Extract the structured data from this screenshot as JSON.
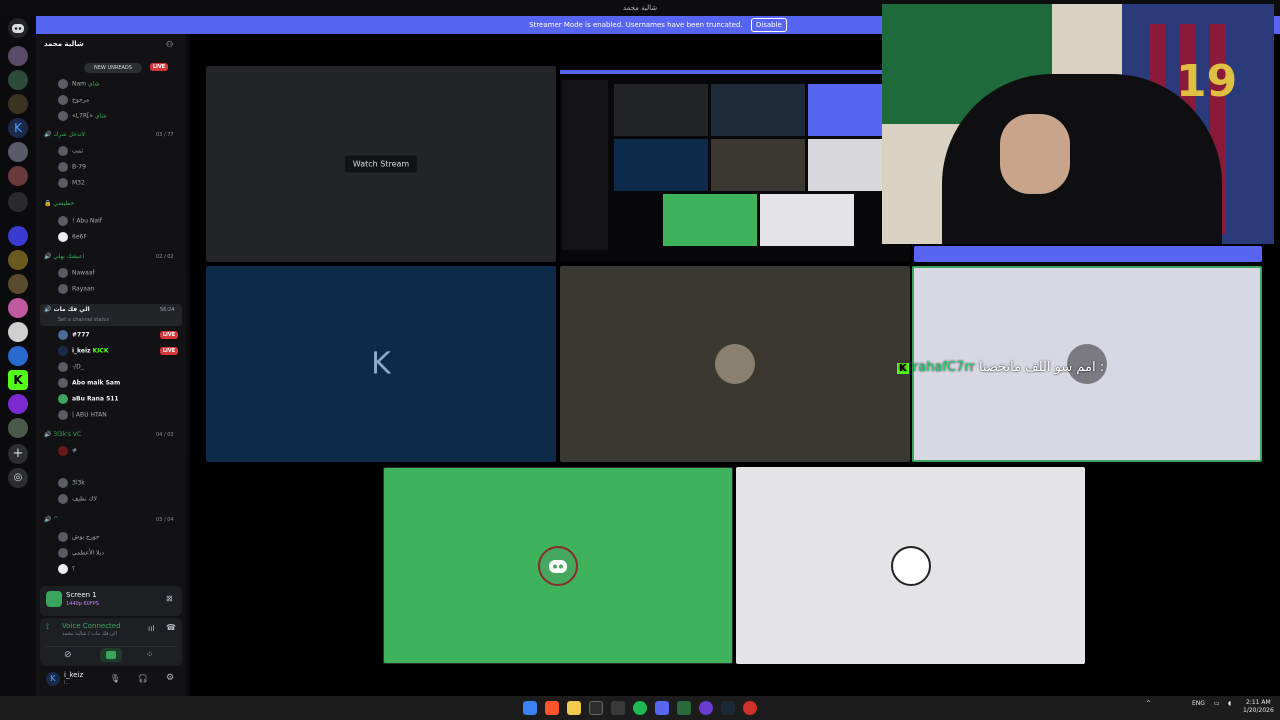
{
  "window": {
    "title": "شالية محمد"
  },
  "banner": {
    "text": "Streamer Mode is enabled. Usernames have been truncated.",
    "disable_label": "Disable"
  },
  "sidebar": {
    "guild_name": "شالية محمد",
    "new_unreads": "NEW UNREADS",
    "channels": [
      {
        "label": "Nam",
        "tag": "شاي"
      },
      {
        "label": "مرجوح"
      },
      {
        "label": "«L7R[»",
        "tag": "شاي"
      },
      {
        "label": "لاتدخل شرك",
        "kind": "category",
        "count": "03 / 77"
      },
      {
        "label": "تمب"
      },
      {
        "label": "B-79"
      },
      {
        "label": "M32"
      },
      {
        "label": "خطيشي",
        "kind": "category"
      },
      {
        "label": "! Abu Naif"
      },
      {
        "label": "6e6F"
      },
      {
        "label": "اعيشك بهلي",
        "kind": "category",
        "count": "02 / 02"
      },
      {
        "label": "Nawaaf"
      },
      {
        "label": "Rayaan"
      },
      {
        "label": "الي فك مات",
        "kind": "category-selected",
        "count": "56:24",
        "status": "Set a channel status"
      },
      {
        "label": "#777",
        "live": "LIVE"
      },
      {
        "label": "i_keiz",
        "tag": "KICK",
        "live": "LIVE"
      },
      {
        "label": "-/D_"
      },
      {
        "label": "Abo malk",
        "tag": "Sam"
      },
      {
        "label": "aBu Rana",
        "tag": "511"
      },
      {
        "label": "| ABU HTAN"
      },
      {
        "label": "3l3k's VC",
        "kind": "category",
        "count": "04 / 03"
      },
      {
        "label": "#"
      },
      {
        "label": "3l3k"
      },
      {
        "label": "لاك",
        "tag": "نظيف"
      },
      {
        "label": "^",
        "kind": "category",
        "count": "03 / 04"
      },
      {
        "label": "جورج بوش"
      },
      {
        "label": "ديلا الأعظمي"
      },
      {
        "label": "؟"
      }
    ],
    "screen_share": {
      "title": "Screen 1",
      "sub": "1440p 60FPS"
    },
    "voice": {
      "status": "Voice Connected",
      "channel": "الي فك مات / شالية محمد"
    },
    "user": {
      "name": "i_keiz",
      "sub": "i..."
    }
  },
  "stage": {
    "watch_stream_label": "Watch Stream",
    "k_letter": "K"
  },
  "overlay": {
    "user": "rahafC7rr",
    "message": "امم سو اللف ماتخصنا :"
  },
  "taskbar": {
    "lang": "ENG",
    "time": "2:11 AM",
    "date": "1/20/2026"
  },
  "colors": {
    "blurple": "#5865f2",
    "discord_green": "#3ba55d",
    "live_red": "#da373c",
    "stage_green": "#3fb35c"
  }
}
